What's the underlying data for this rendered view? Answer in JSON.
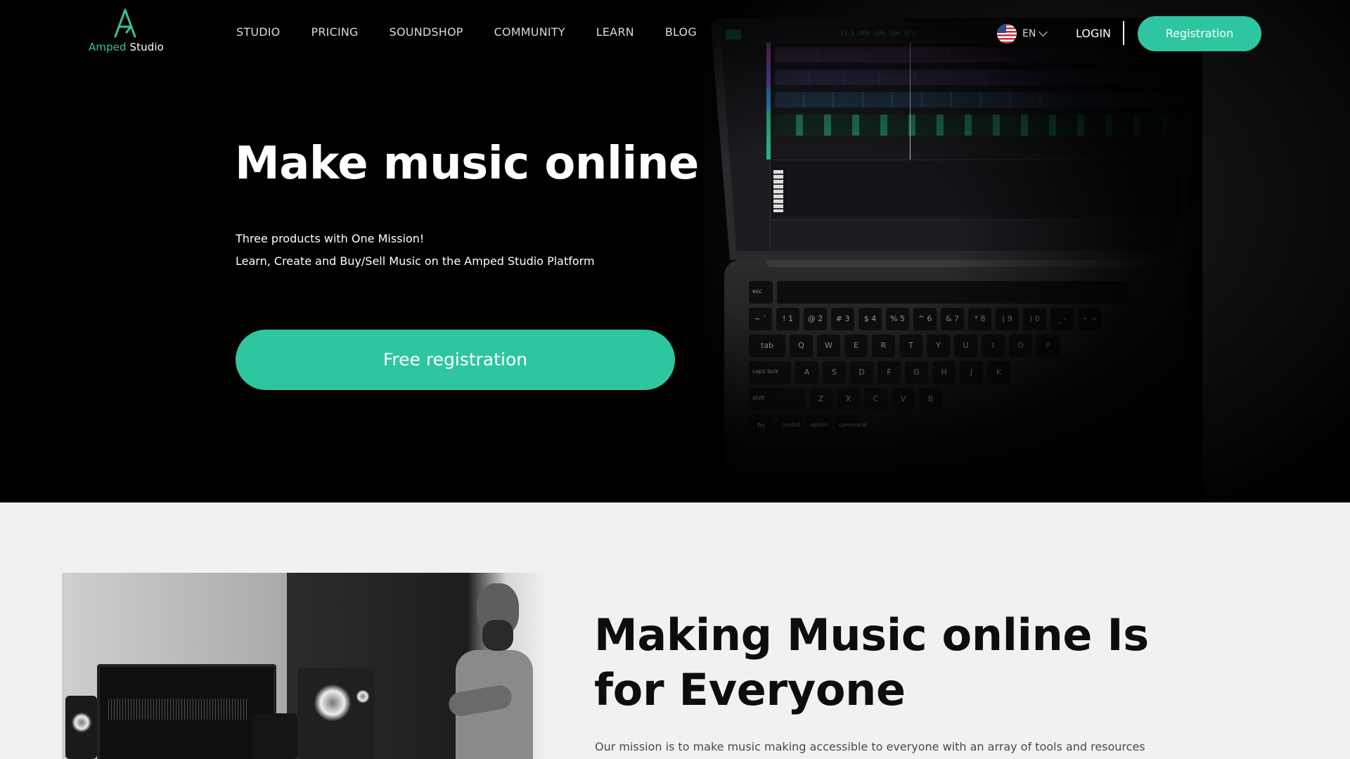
{
  "logo": {
    "brand_a": "Amped",
    "brand_b": "Studio"
  },
  "nav": {
    "items": [
      "STUDIO",
      "PRICING",
      "SOUNDSHOP",
      "COMMUNITY",
      "LEARN",
      "BLOG"
    ]
  },
  "header": {
    "lang_code": "EN",
    "lang_icon": "us-flag-icon",
    "login_label": "LOGIN",
    "register_label": "Registration"
  },
  "hero": {
    "title": "Make music online",
    "subtitle_line1": "Three products with One Mission!",
    "subtitle_line2": "Learn, Create and Buy/Sell Music on the Amped Studio Platform",
    "cta_label": "Free registration"
  },
  "laptop_screen": {
    "timecode": "13.1.000   106 bpm   4/4"
  },
  "keyboard": {
    "row1": [
      "esc"
    ],
    "row2": [
      "~ `",
      "! 1",
      "@ 2",
      "# 3",
      "$ 4",
      "% 5",
      "^ 6",
      "& 7",
      "* 8",
      "( 9",
      ") 0",
      "_ -",
      "+ ="
    ],
    "row3": [
      "tab",
      "Q",
      "W",
      "E",
      "R",
      "T",
      "Y",
      "U",
      "I",
      "O",
      "P"
    ],
    "row4": [
      "caps lock",
      "A",
      "S",
      "D",
      "F",
      "G",
      "H",
      "J",
      "K"
    ],
    "row5": [
      "shift",
      "Z",
      "X",
      "C",
      "V",
      "B"
    ],
    "row6": [
      "fn",
      "control",
      "option",
      "command"
    ]
  },
  "section2": {
    "title_line1": "Making Music online Is",
    "title_line2": "for Everyone",
    "text": "Our mission is to make music making accessible to everyone with an array of tools and resources"
  },
  "colors": {
    "accent": "#2ec69e",
    "hero_bg": "#000000",
    "section_bg": "#f1f1f1"
  }
}
